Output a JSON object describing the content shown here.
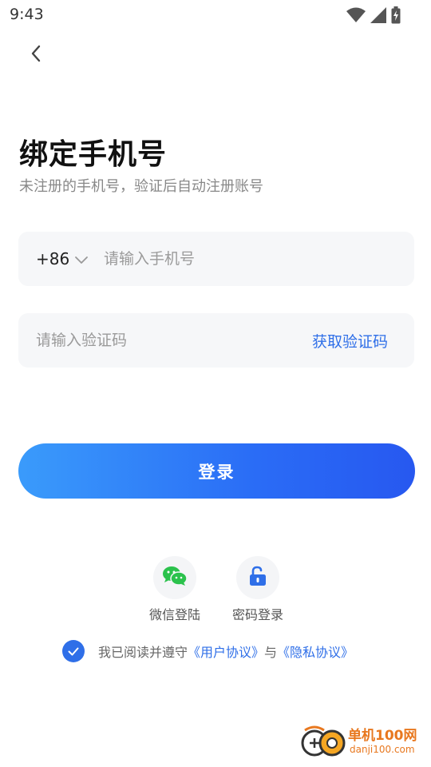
{
  "status_bar": {
    "time": "9:43",
    "icons": [
      "wifi-icon",
      "signal-icon",
      "battery-icon"
    ]
  },
  "header": {
    "back_icon": "chevron-left-icon"
  },
  "title": "绑定手机号",
  "subtitle": "未注册的手机号，验证后自动注册账号",
  "phone_field": {
    "country_code": "+86",
    "placeholder": "请输入手机号",
    "value": ""
  },
  "code_field": {
    "placeholder": "请输入验证码",
    "value": "",
    "get_code_label": "获取验证码"
  },
  "login_button": {
    "label": "登录"
  },
  "alt_logins": [
    {
      "label": "微信登陆",
      "icon": "wechat-icon",
      "color": "#2bc24c"
    },
    {
      "label": "密码登录",
      "icon": "unlock-icon",
      "color": "#2f6fe8"
    }
  ],
  "agreement": {
    "checked": true,
    "prefix": "我已阅读并遵守",
    "user_agreement": "《用户协议》",
    "connector": "与",
    "privacy_policy": "《隐私协议》"
  },
  "watermark": {
    "name": "单机100网",
    "domain": "danji100.com"
  },
  "colors": {
    "accent": "#2f6fe8",
    "button_gradient_start": "#3a9bfb",
    "button_gradient_end": "#2758f0",
    "field_bg": "#f6f7f9"
  }
}
